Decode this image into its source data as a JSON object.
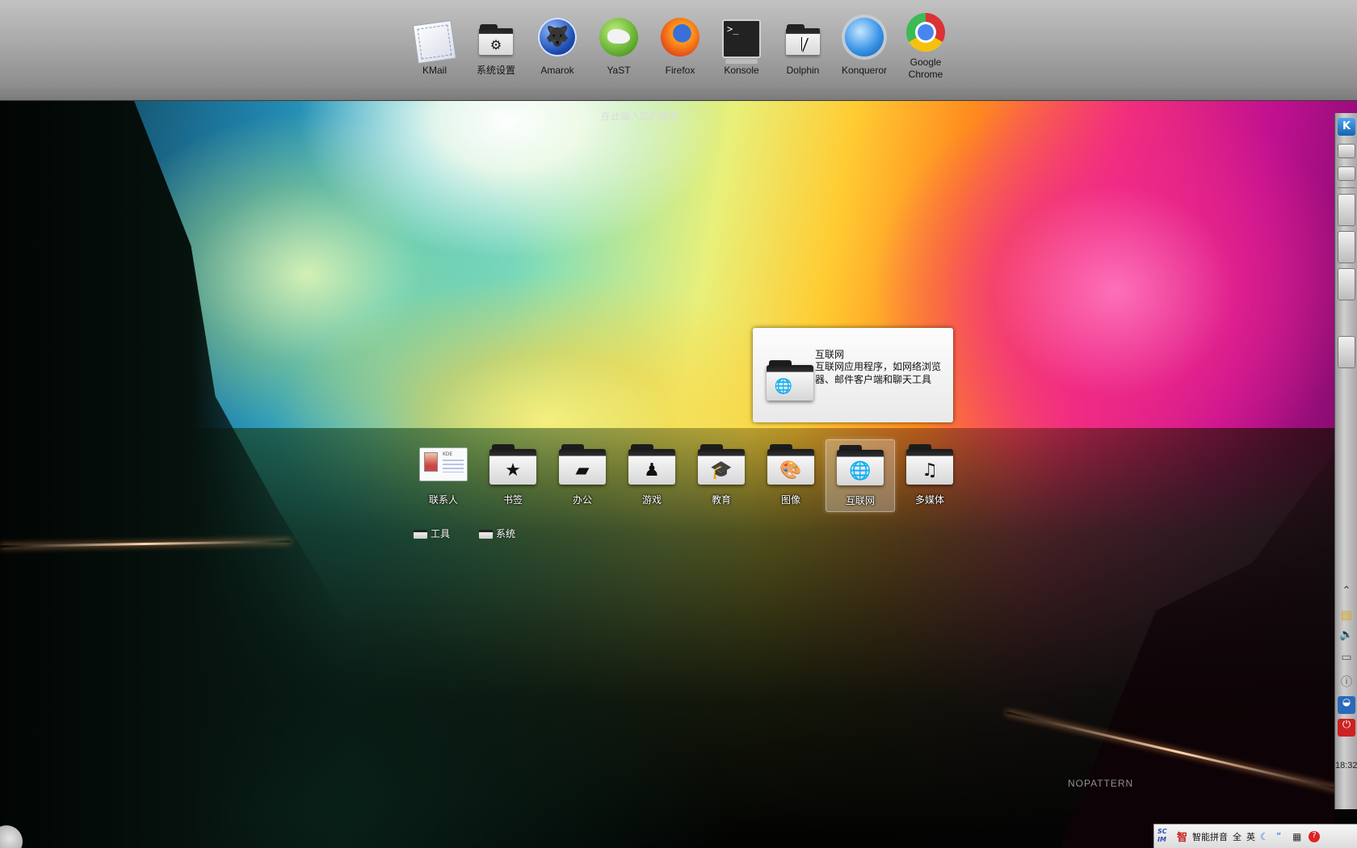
{
  "favorites": [
    {
      "label": "KMail",
      "icon": "kmail-icon"
    },
    {
      "label": "系统设置",
      "icon": "system-settings-icon"
    },
    {
      "label": "Amarok",
      "icon": "amarok-icon"
    },
    {
      "label": "YaST",
      "icon": "yast-icon"
    },
    {
      "label": "Firefox",
      "icon": "firefox-icon"
    },
    {
      "label": "Konsole",
      "icon": "konsole-icon"
    },
    {
      "label": "Dolphin",
      "icon": "dolphin-icon"
    },
    {
      "label": "Konqueror",
      "icon": "konqueror-icon"
    },
    {
      "label": "Google\nChrome",
      "icon": "chrome-icon"
    }
  ],
  "search": {
    "placeholder": "在此输入您的查询"
  },
  "tooltip": {
    "title": "互联网",
    "description": "互联网应用程序，如网络浏览器、邮件客户端和聊天工具"
  },
  "categories": [
    {
      "label": "联系人",
      "icon": "contacts-icon"
    },
    {
      "label": "书签",
      "icon": "bookmarks-icon"
    },
    {
      "label": "办公",
      "icon": "office-icon"
    },
    {
      "label": "游戏",
      "icon": "games-icon"
    },
    {
      "label": "教育",
      "icon": "education-icon"
    },
    {
      "label": "图像",
      "icon": "graphics-icon"
    },
    {
      "label": "互联网",
      "icon": "internet-icon",
      "hovered": true
    },
    {
      "label": "多媒体",
      "icon": "multimedia-icon"
    }
  ],
  "subcategories": [
    {
      "label": "工具",
      "icon": "utilities-icon"
    },
    {
      "label": "系统",
      "icon": "system-icon"
    }
  ],
  "panel": {
    "clock": "18:32"
  },
  "ime": {
    "logo": "SC IM",
    "brand_char": "智",
    "name": "智能拼音",
    "full_width": "全",
    "lang": "英"
  },
  "wallpaper": {
    "signature": "NOPATTERN"
  }
}
